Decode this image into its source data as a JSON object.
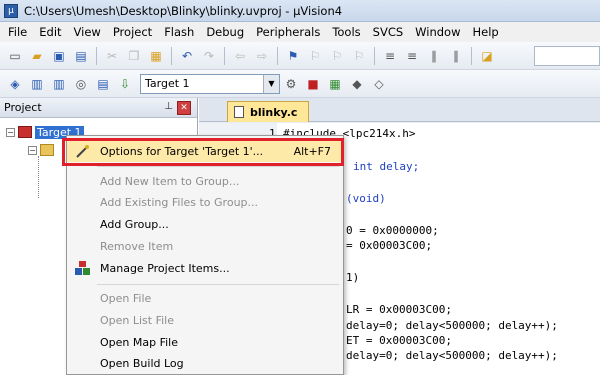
{
  "window": {
    "title": "C:\\Users\\Umesh\\Desktop\\Blinky\\blinky.uvproj - µVision4"
  },
  "menubar": {
    "items": [
      "File",
      "Edit",
      "View",
      "Project",
      "Flash",
      "Debug",
      "Peripherals",
      "Tools",
      "SVCS",
      "Window",
      "Help"
    ]
  },
  "toolbar2": {
    "target": "Target 1"
  },
  "project_panel": {
    "title": "Project",
    "tree": {
      "target_label": "Target 1"
    }
  },
  "editor": {
    "tab_label": "blinky.c",
    "lines": [
      {
        "no": "1",
        "text": "#include <lpc214x.h>"
      },
      {
        "no": "",
        "text": "int delay;"
      },
      {
        "no": "",
        "text": "(void)"
      },
      {
        "no": "",
        "text": "0 = 0x0000000;"
      },
      {
        "no": "",
        "text": "= 0x00003C00;"
      },
      {
        "no": "",
        "text": "1)"
      },
      {
        "no": "",
        "text": "LR = 0x00003C00;"
      },
      {
        "no": "",
        "text": "delay=0; delay<500000; delay++);"
      },
      {
        "no": "",
        "text": "ET = 0x00003C00;"
      },
      {
        "no": "",
        "text": "delay=0; delay<500000; delay++);"
      }
    ]
  },
  "context_menu": {
    "items": [
      {
        "label": "Options for Target 'Target 1'...",
        "shortcut": "Alt+F7",
        "enabled": true
      },
      {
        "label": "Add New Item to Group...",
        "enabled": false
      },
      {
        "label": "Add Existing Files to Group...",
        "enabled": false
      },
      {
        "label": "Add Group...",
        "enabled": true
      },
      {
        "label": "Remove Item",
        "enabled": false
      },
      {
        "label": "Manage Project Items...",
        "enabled": true
      },
      {
        "label": "Open File",
        "enabled": false
      },
      {
        "label": "Open List File",
        "enabled": false
      },
      {
        "label": "Open Map File",
        "enabled": true
      },
      {
        "label": "Open Build Log",
        "enabled": true
      }
    ]
  },
  "colors": {
    "highlight_border": "#e0202b",
    "selection": "#3070d0",
    "tab_active": "#ffe79a"
  }
}
